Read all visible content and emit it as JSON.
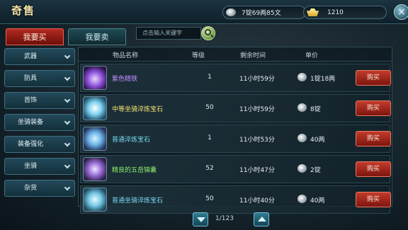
{
  "header": {
    "title": "奇售",
    "silver_amount": "7锭69两85文",
    "gold_amount": "1210",
    "close_label": "×"
  },
  "tabs": [
    {
      "label": "我要买",
      "active": true
    },
    {
      "label": "我要卖",
      "active": false
    }
  ],
  "search": {
    "placeholder": "点击输入关键字"
  },
  "sidebar": {
    "items": [
      {
        "label": "武器"
      },
      {
        "label": "防具"
      },
      {
        "label": "首饰"
      },
      {
        "label": "坐骑装备"
      },
      {
        "label": "装备强化"
      },
      {
        "label": "坐骑"
      },
      {
        "label": "杂货"
      }
    ]
  },
  "table": {
    "headers": {
      "name": "物品名称",
      "level": "等级",
      "time": "剩余时间",
      "price": "单价"
    },
    "buy_label": "购买",
    "rows": [
      {
        "name": "紫色精铁",
        "level": "1",
        "time": "11小时59分",
        "price": "1锭18两",
        "name_color": "#c58cff"
      },
      {
        "name": "中等坐骑淬炼宝石",
        "level": "50",
        "time": "11小时59分",
        "price": "8锭",
        "name_color": "#f4e170"
      },
      {
        "name": "普通淬炼宝石",
        "level": "1",
        "time": "11小时53分",
        "price": "40两",
        "name_color": "#7ad8f0"
      },
      {
        "name": "精良的五岳锦囊",
        "level": "52",
        "time": "11小时47分",
        "price": "2锭",
        "name_color": "#8ff06d"
      },
      {
        "name": "普通坐骑淬炼宝石",
        "level": "50",
        "time": "11小时40分",
        "price": "40两",
        "name_color": "#7ad8f0"
      }
    ]
  },
  "pager": {
    "page_text": "1/123"
  },
  "colors": {
    "accent_red": "#b22a22",
    "panel_teal": "#23495a"
  }
}
